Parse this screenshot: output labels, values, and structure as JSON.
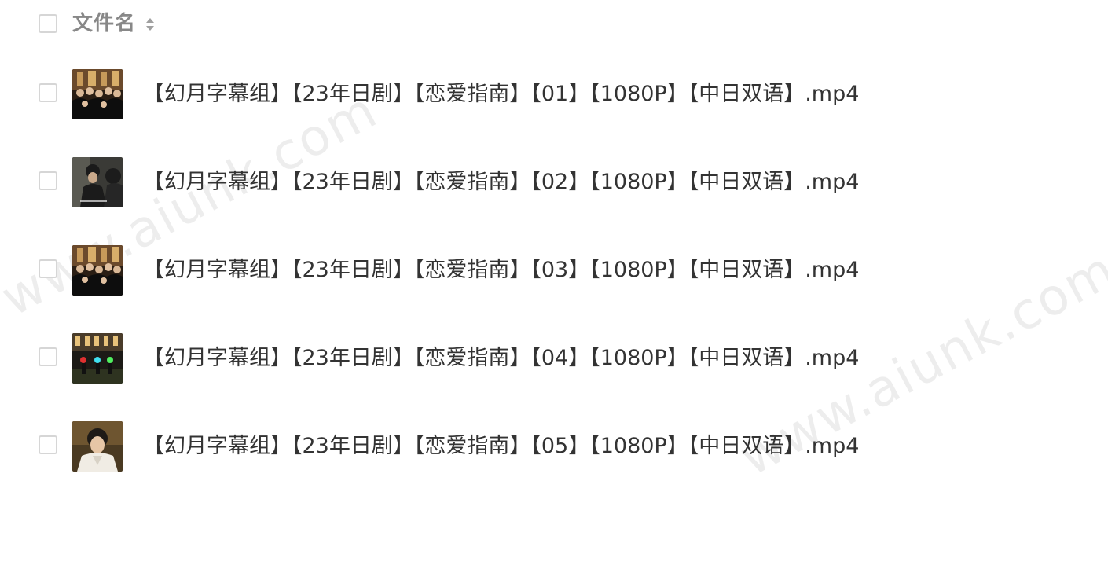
{
  "header": {
    "column_label": "文件名",
    "sort_icon": "sort-icon"
  },
  "files": [
    {
      "name": "【幻月字幕组】【23年日剧】【恋爱指南】【01】【1080P】【中日双语】.mp4",
      "thumbnail": "group-photo-thumbnail"
    },
    {
      "name": "【幻月字幕组】【23年日剧】【恋爱指南】【02】【1080P】【中日双语】.mp4",
      "thumbnail": "two-people-thumbnail"
    },
    {
      "name": "【幻月字幕组】【23年日剧】【恋爱指南】【03】【1080P】【中日双语】.mp4",
      "thumbnail": "group-photo-thumbnail"
    },
    {
      "name": "【幻月字幕组】【23年日剧】【恋爱指南】【04】【1080P】【中日双语】.mp4",
      "thumbnail": "night-lights-thumbnail"
    },
    {
      "name": "【幻月字幕组】【23年日剧】【恋爱指南】【05】【1080P】【中日双语】.mp4",
      "thumbnail": "portrait-thumbnail"
    }
  ],
  "watermark": "www.aiunk.com"
}
